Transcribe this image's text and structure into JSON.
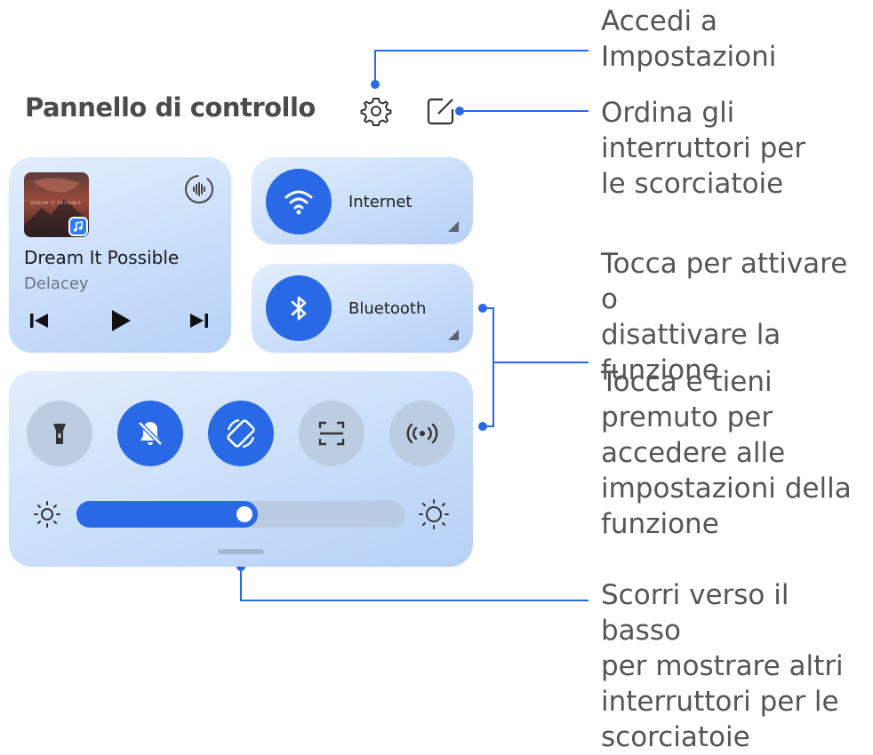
{
  "header": {
    "title": "Pannello di controllo",
    "settings_icon": "gear-icon",
    "edit_icon": "edit-square-icon"
  },
  "music": {
    "album_caption": "DREAM IT POSSIBLE",
    "song": "Dream It Possible",
    "artist": "Delacey",
    "controls": [
      "previous-icon",
      "play-icon",
      "next-icon"
    ],
    "cast_icon": "audio-output-icon"
  },
  "tiles": {
    "internet": {
      "label": "Internet",
      "icon": "wifi-icon",
      "state": "on"
    },
    "bluetooth": {
      "label": "Bluetooth",
      "icon": "bluetooth-icon",
      "state": "on"
    }
  },
  "toggles": [
    {
      "name": "flashlight",
      "icon": "flashlight-icon",
      "state": "off"
    },
    {
      "name": "silent",
      "icon": "bell-off-icon",
      "state": "on"
    },
    {
      "name": "auto-rotate",
      "icon": "rotate-icon",
      "state": "on"
    },
    {
      "name": "scan",
      "icon": "scan-icon",
      "state": "off"
    },
    {
      "name": "hotspot",
      "icon": "hotspot-icon",
      "state": "off"
    }
  ],
  "brightness": {
    "level": 0.55
  },
  "annotations": {
    "settings": "Accedi a\nImpostazioni",
    "edit": "Ordina gli\ninterruttori per\nle scorciatoie",
    "tap": "Tocca per attivare o\ndisattivare la\nfunzione",
    "hold": "Tocca e tieni\npremuto per\naccedere alle\nimpostazioni della\nfunzione",
    "swipe": "Scorri verso il basso\nper mostrare altri\ninterruttori per le\nscorciatoie"
  },
  "colors": {
    "accent": "#2a69e6",
    "callout": "#2a69e6",
    "card": "#c9defa",
    "inactive": "#bccde2"
  }
}
